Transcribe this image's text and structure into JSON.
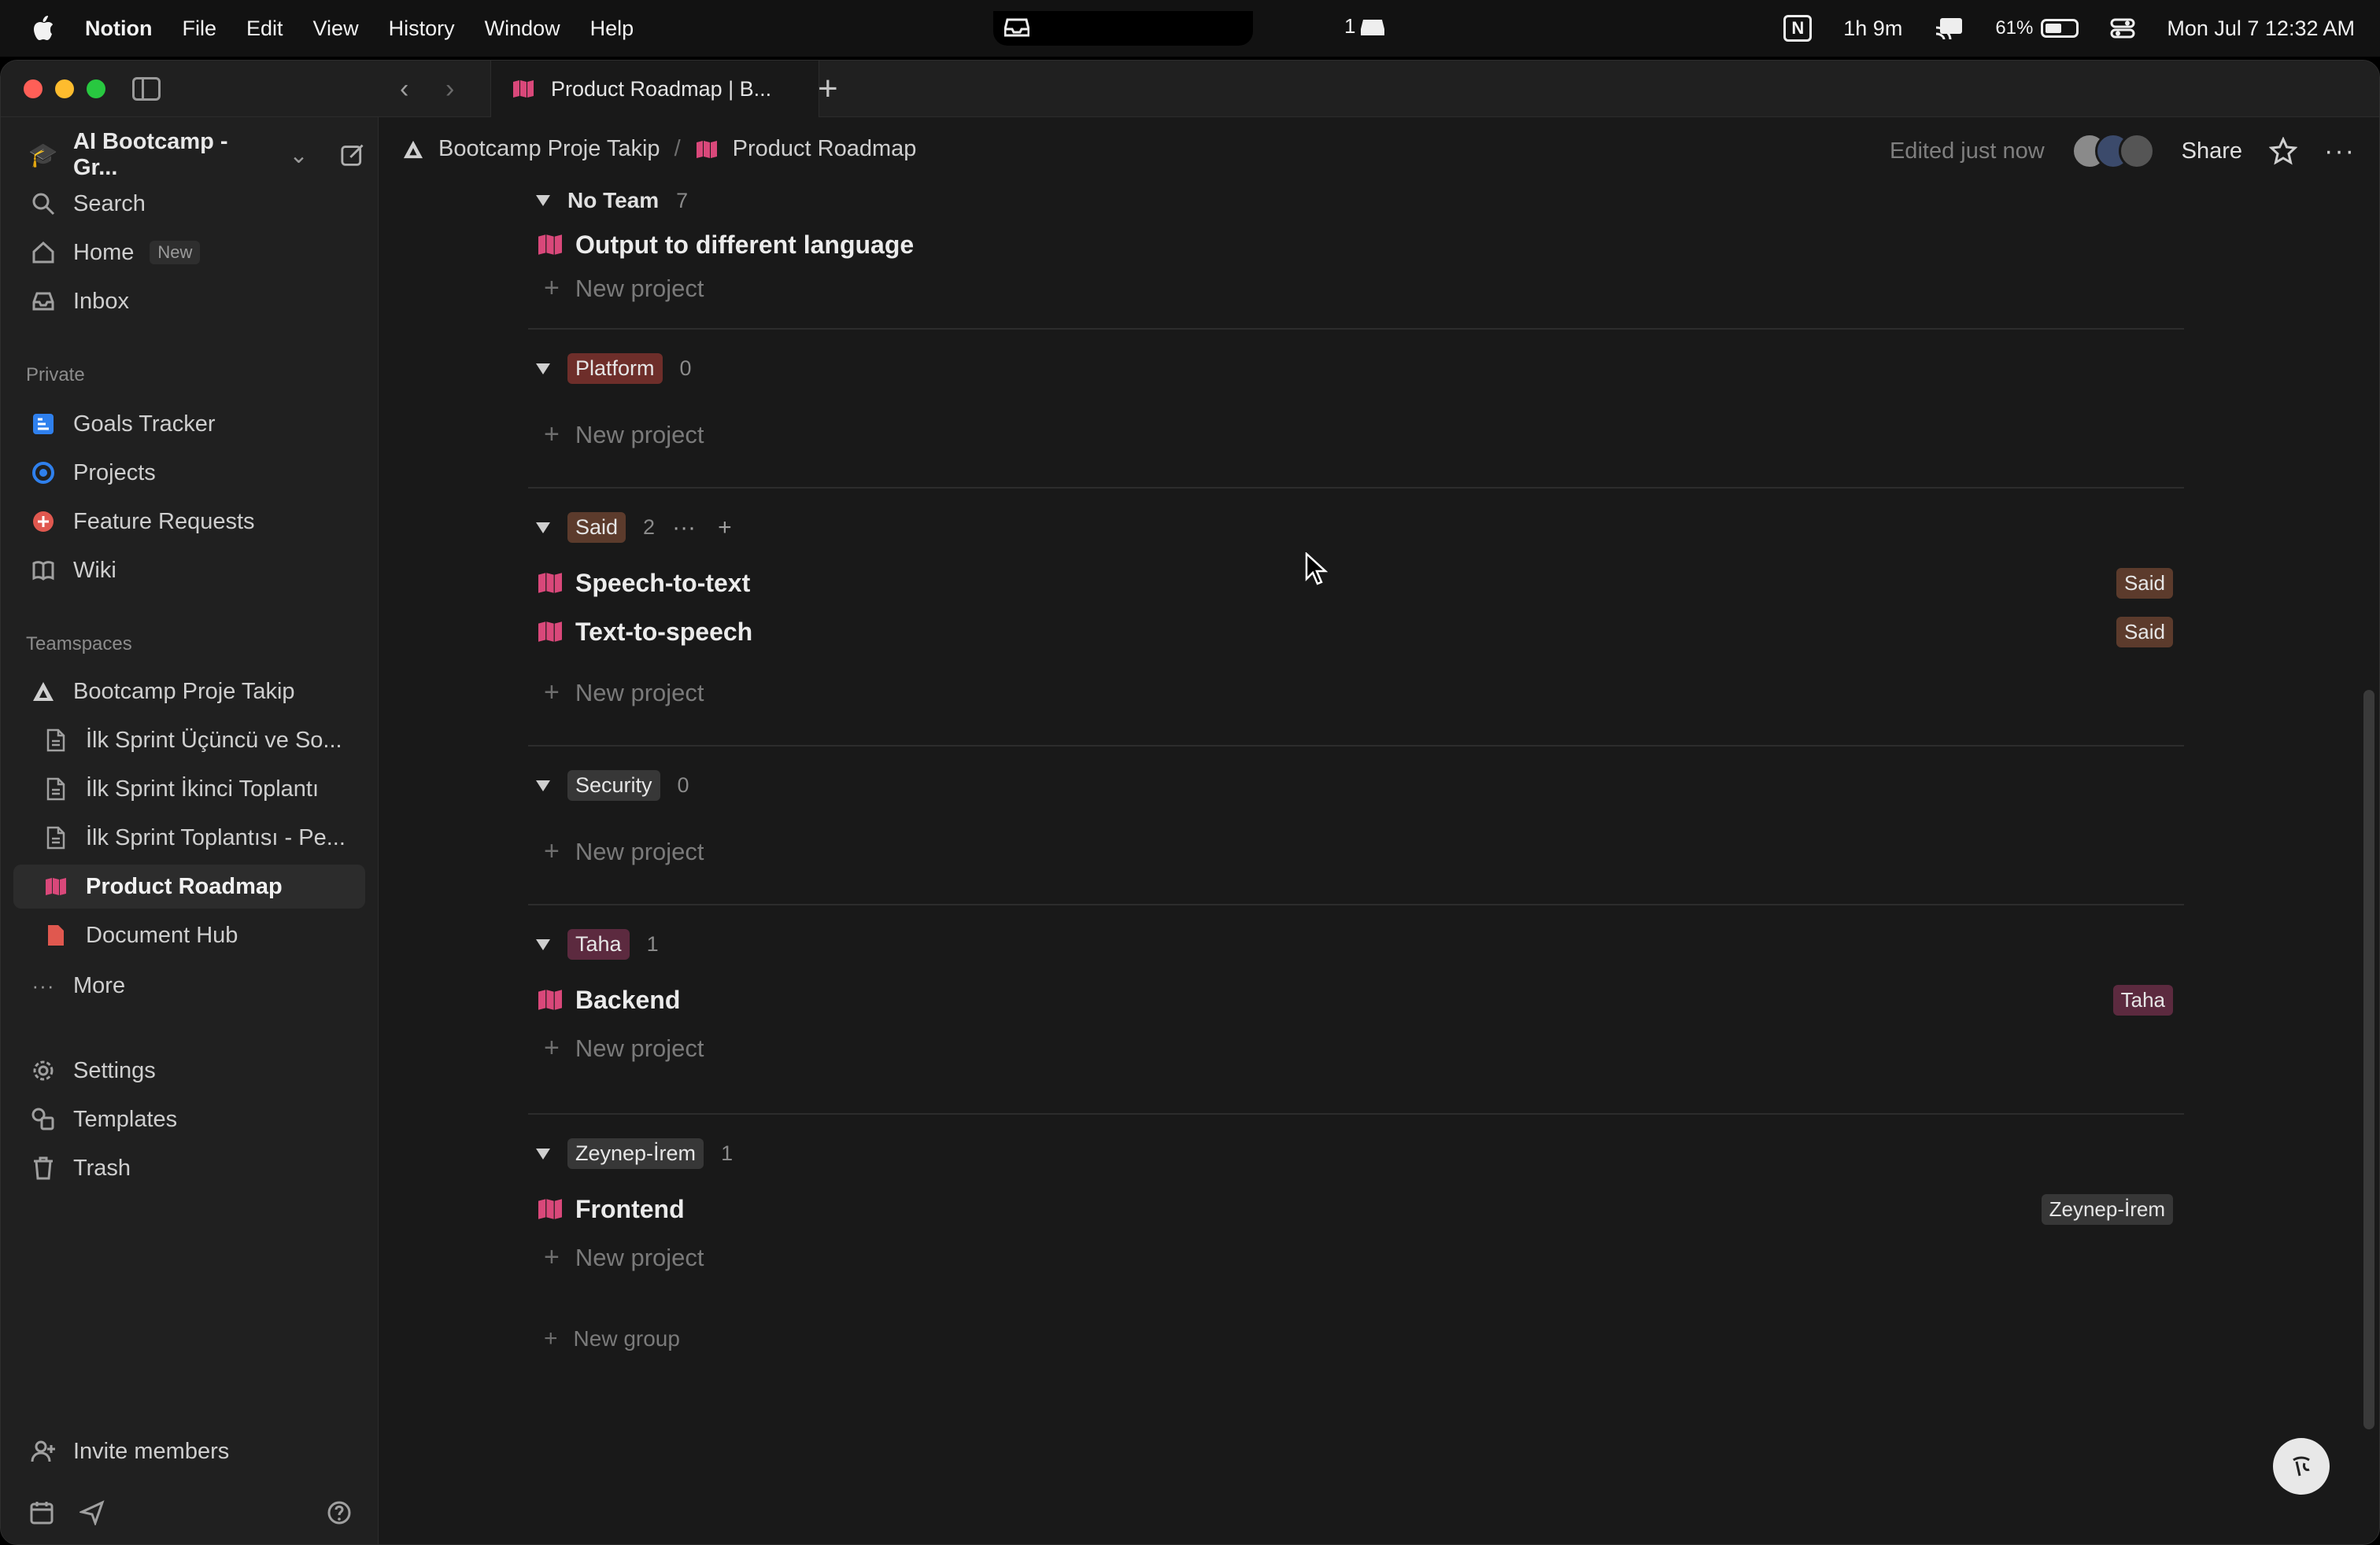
{
  "menubar": {
    "app_name": "Notion",
    "menus": [
      "File",
      "Edit",
      "View",
      "History",
      "Window",
      "Help"
    ],
    "notch_badge": "1",
    "status": {
      "timer": "1h 9m",
      "battery_percent": "61%",
      "battery_level": 0.61,
      "datetime": "Mon Jul 7  12:32 AM"
    }
  },
  "tab": {
    "title": "Product Roadmap | B..."
  },
  "sidebar": {
    "workspace": "AI Bootcamp - Gr...",
    "top_items": [
      {
        "label": "Search",
        "icon": "search-icon"
      },
      {
        "label": "Home",
        "icon": "home-icon",
        "badge": "New"
      },
      {
        "label": "Inbox",
        "icon": "inbox-icon"
      }
    ],
    "private_label": "Private",
    "private_items": [
      {
        "label": "Goals Tracker",
        "icon": "goals-icon",
        "color": "#2f80ed"
      },
      {
        "label": "Projects",
        "icon": "projects-icon",
        "color": "#2f80ed"
      },
      {
        "label": "Feature Requests",
        "icon": "feature-requests-icon",
        "color": "#e0584f"
      },
      {
        "label": "Wiki",
        "icon": "book-icon"
      }
    ],
    "teamspaces_label": "Teamspaces",
    "teamspace": "Bootcamp Proje Takip",
    "teamspace_items": [
      {
        "label": "İlk Sprint Üçüncü ve So...",
        "icon": "page-icon"
      },
      {
        "label": "İlk Sprint İkinci Toplantı",
        "icon": "page-icon"
      },
      {
        "label": "İlk Sprint Toplantısı - Pe...",
        "icon": "page-icon"
      },
      {
        "label": "Product Roadmap",
        "icon": "roadmap-icon",
        "selected": true
      },
      {
        "label": "Document Hub",
        "icon": "document-hub-icon"
      }
    ],
    "more": "More",
    "bottom_items": [
      {
        "label": "Settings",
        "icon": "gear-icon"
      },
      {
        "label": "Templates",
        "icon": "templates-icon"
      },
      {
        "label": "Trash",
        "icon": "trash-icon"
      }
    ],
    "invite": "Invite members"
  },
  "header": {
    "breadcrumb": [
      "Bootcamp Proje Takip",
      "Product Roadmap"
    ],
    "edited": "Edited just now",
    "share": "Share"
  },
  "board": {
    "new_project": "New project",
    "new_group": "New group",
    "groups": [
      {
        "name": "No Team",
        "count": "7",
        "tag_color": null,
        "items": [
          {
            "title": "Output to different language",
            "tag": null
          }
        ]
      },
      {
        "name": "Platform",
        "count": "0",
        "tag_color": "#6e2e2a",
        "items": []
      },
      {
        "name": "Said",
        "count": "2",
        "tag_color": "#5c3b2c",
        "items": [
          {
            "title": "Speech-to-text",
            "tag": "Said"
          },
          {
            "title": "Text-to-speech",
            "tag": "Said"
          }
        ]
      },
      {
        "name": "Security",
        "count": "0",
        "tag_color": "#373737",
        "items": []
      },
      {
        "name": "Taha",
        "count": "1",
        "tag_color": "#5c2a3f",
        "items": [
          {
            "title": "Backend",
            "tag": "Taha"
          }
        ]
      },
      {
        "name": "Zeynep-İrem",
        "count": "1",
        "tag_color": "#373737",
        "items": [
          {
            "title": "Frontend",
            "tag": "Zeynep-İrem"
          }
        ]
      }
    ]
  },
  "colors": {
    "roadmap_pink": "#d9487a",
    "window_bg": "#191919",
    "sidebar_bg": "#202020"
  }
}
